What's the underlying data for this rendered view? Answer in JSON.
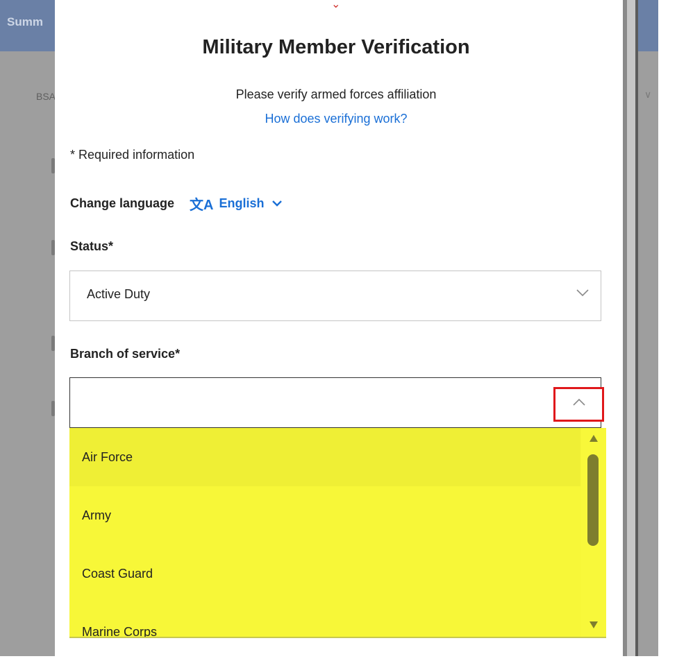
{
  "background": {
    "header_title": "Summ",
    "sub_label": "BSA",
    "chevron": "∨"
  },
  "modal": {
    "top_chevron": "⌄",
    "title": "Military Member Verification",
    "subtitle": "Please verify armed forces affiliation",
    "how_link": "How does verifying work?",
    "required_note": "* Required information",
    "language": {
      "label": "Change language",
      "icon_glyph": "文A",
      "value": "English"
    },
    "status": {
      "label": "Status*",
      "value": "Active Duty"
    },
    "branch": {
      "label": "Branch of service*",
      "value": "",
      "options": [
        "Air Force",
        "Army",
        "Coast Guard",
        "Marine Corps"
      ],
      "hovered_option": "Air Force"
    }
  },
  "colors": {
    "link_blue": "#1a6fd6",
    "highlight_yellow": "#f7f738",
    "callout_red": "#e0181b"
  },
  "icons": {
    "language": "translate-icon",
    "chevron_down": "chevron-down-icon",
    "chevron_up": "chevron-up-icon",
    "scroll_up": "scroll-up-arrow-icon",
    "scroll_down": "scroll-down-arrow-icon"
  }
}
